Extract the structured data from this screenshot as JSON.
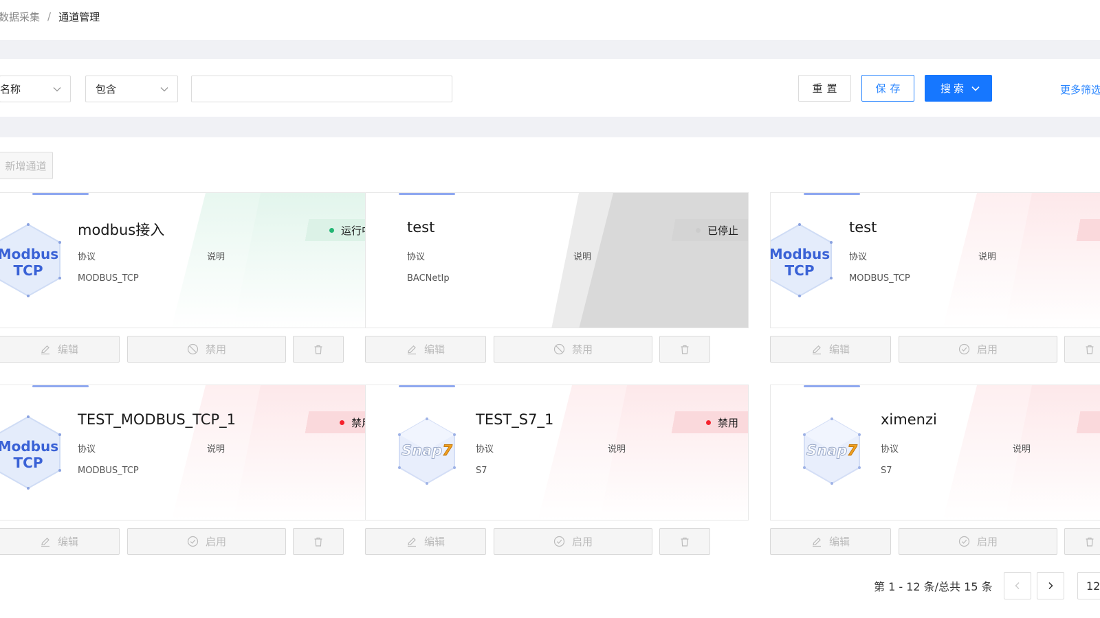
{
  "breadcrumb": {
    "first": "数据采集",
    "separator": "/",
    "current": "通道管理"
  },
  "filter": {
    "field_value": "名称",
    "operator_value": "包含",
    "search_value": "",
    "search_placeholder": "",
    "reset_label": "重置",
    "save_label": "保存",
    "search_label": "搜索",
    "more_label": "更多筛选"
  },
  "toolbar": {
    "add_label": "新增通道"
  },
  "card_labels": {
    "protocol": "协议",
    "description": "说明"
  },
  "actions": {
    "edit": "编辑",
    "disable": "禁用",
    "enable": "启用"
  },
  "cards": [
    {
      "name": "modbus接入",
      "protocol": "MODBUS_TCP",
      "status": "运行中",
      "status_type": "running",
      "logo": "modbus",
      "logo_line1": "Modbus",
      "logo_line2": "TCP",
      "toggle": "disable"
    },
    {
      "name": "test",
      "protocol": "BACNetIp",
      "status": "已停止",
      "status_type": "stopped",
      "logo": "none",
      "toggle": "disable"
    },
    {
      "name": "test",
      "protocol": "MODBUS_TCP",
      "status": "",
      "status_type": "disabled",
      "logo": "modbus",
      "logo_line1": "Modbus",
      "logo_line2": "TCP",
      "toggle": "enable"
    },
    {
      "name": "TEST_MODBUS_TCP_1",
      "protocol": "MODBUS_TCP",
      "status": "禁用",
      "status_type": "disabled",
      "logo": "modbus",
      "logo_line1": "Modbus",
      "logo_line2": "TCP",
      "toggle": "enable"
    },
    {
      "name": "TEST_S7_1",
      "protocol": "S7",
      "status": "禁用",
      "status_type": "disabled",
      "logo": "snap7",
      "logo_line1": "Snap7",
      "toggle": "enable"
    },
    {
      "name": "ximenzi",
      "protocol": "S7",
      "status": "",
      "status_type": "disabled",
      "logo": "snap7",
      "logo_line1": "Snap7",
      "toggle": "enable"
    }
  ],
  "pagination": {
    "summary": "第 1 - 12 条/总共 15 条",
    "page_size": "12"
  },
  "colors": {
    "primary": "#1677ff",
    "running": "#22b573",
    "disabled": "#f5222d",
    "stopped": "#cccccc"
  }
}
